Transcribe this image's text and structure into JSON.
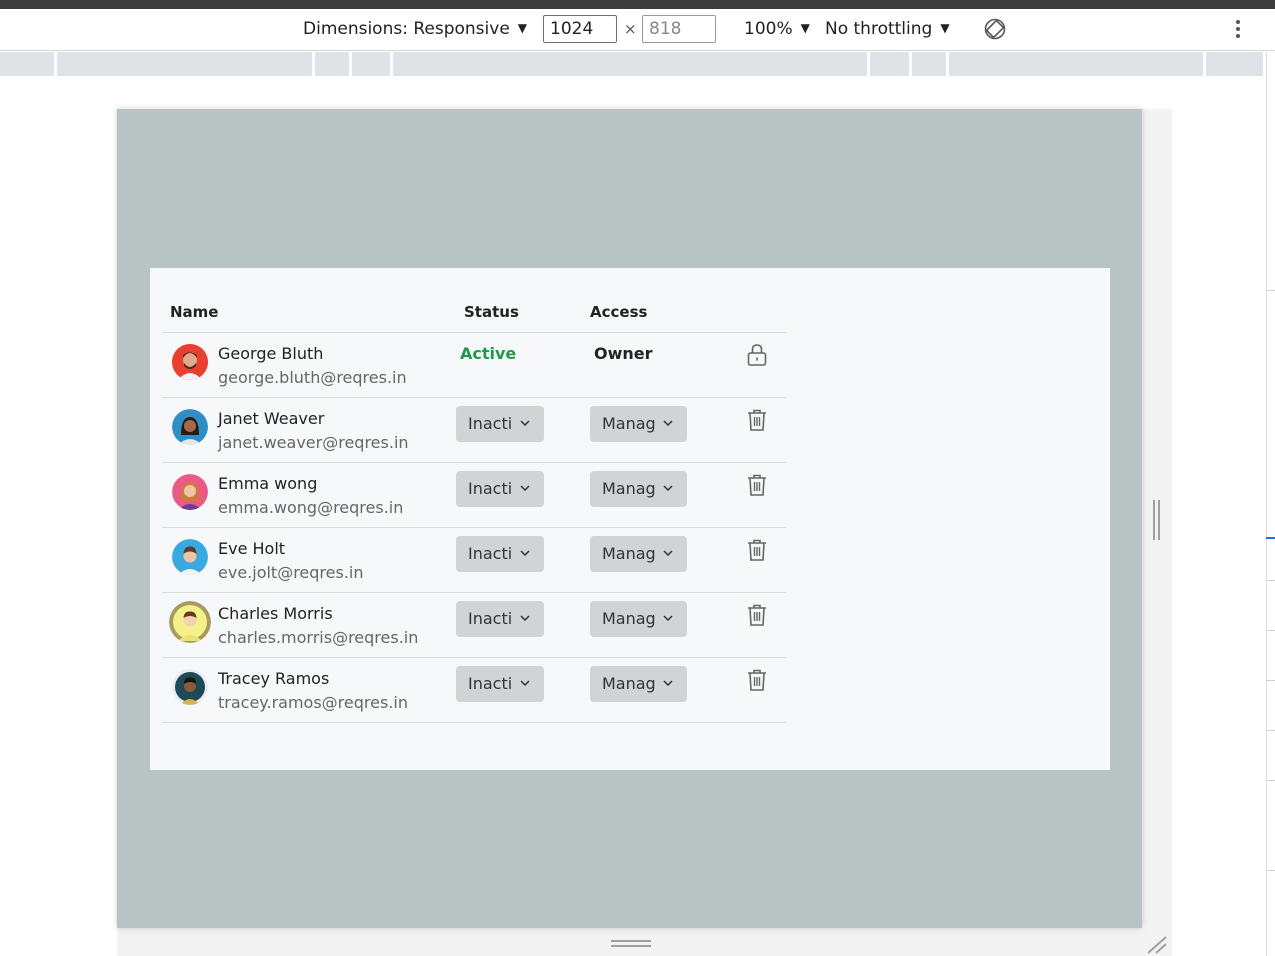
{
  "devtools": {
    "dimensions_label": "Dimensions: Responsive",
    "width_value": "1024",
    "height_placeholder": "818",
    "times": "×",
    "zoom": "100%",
    "throttling": "No throttling",
    "dropdown_arrow": "▼",
    "icons": [
      "rotate-icon",
      "more-vert-icon"
    ]
  },
  "table": {
    "headers": {
      "name": "Name",
      "status": "Status",
      "access": "Access"
    },
    "owner_row": {
      "name": "George Bluth",
      "email": "george.bluth@reqres.in",
      "status": "Active",
      "access": "Owner",
      "icon": "lock-icon"
    },
    "rows": [
      {
        "name": "Janet Weaver",
        "email": "janet.weaver@reqres.in",
        "status": "Inacti",
        "access": "Manag",
        "icon": "trash-icon"
      },
      {
        "name": "Emma wong",
        "email": "emma.wong@reqres.in",
        "status": "Inacti",
        "access": "Manag",
        "icon": "trash-icon"
      },
      {
        "name": "Eve Holt",
        "email": "eve.jolt@reqres.in",
        "status": "Inacti",
        "access": "Manag",
        "icon": "trash-icon"
      },
      {
        "name": "Charles Morris",
        "email": "charles.morris@reqres.in",
        "status": "Inacti",
        "access": "Manag",
        "icon": "trash-icon"
      },
      {
        "name": "Tracey Ramos",
        "email": "tracey.ramos@reqres.in",
        "status": "Inacti",
        "access": "Manag",
        "icon": "trash-icon"
      }
    ]
  },
  "colors": {
    "device_background": "#b8c4c3",
    "card_background": "#f7f8fa",
    "status_active": "#1e9a4b",
    "dropdown_background": "#d1d3d5"
  }
}
